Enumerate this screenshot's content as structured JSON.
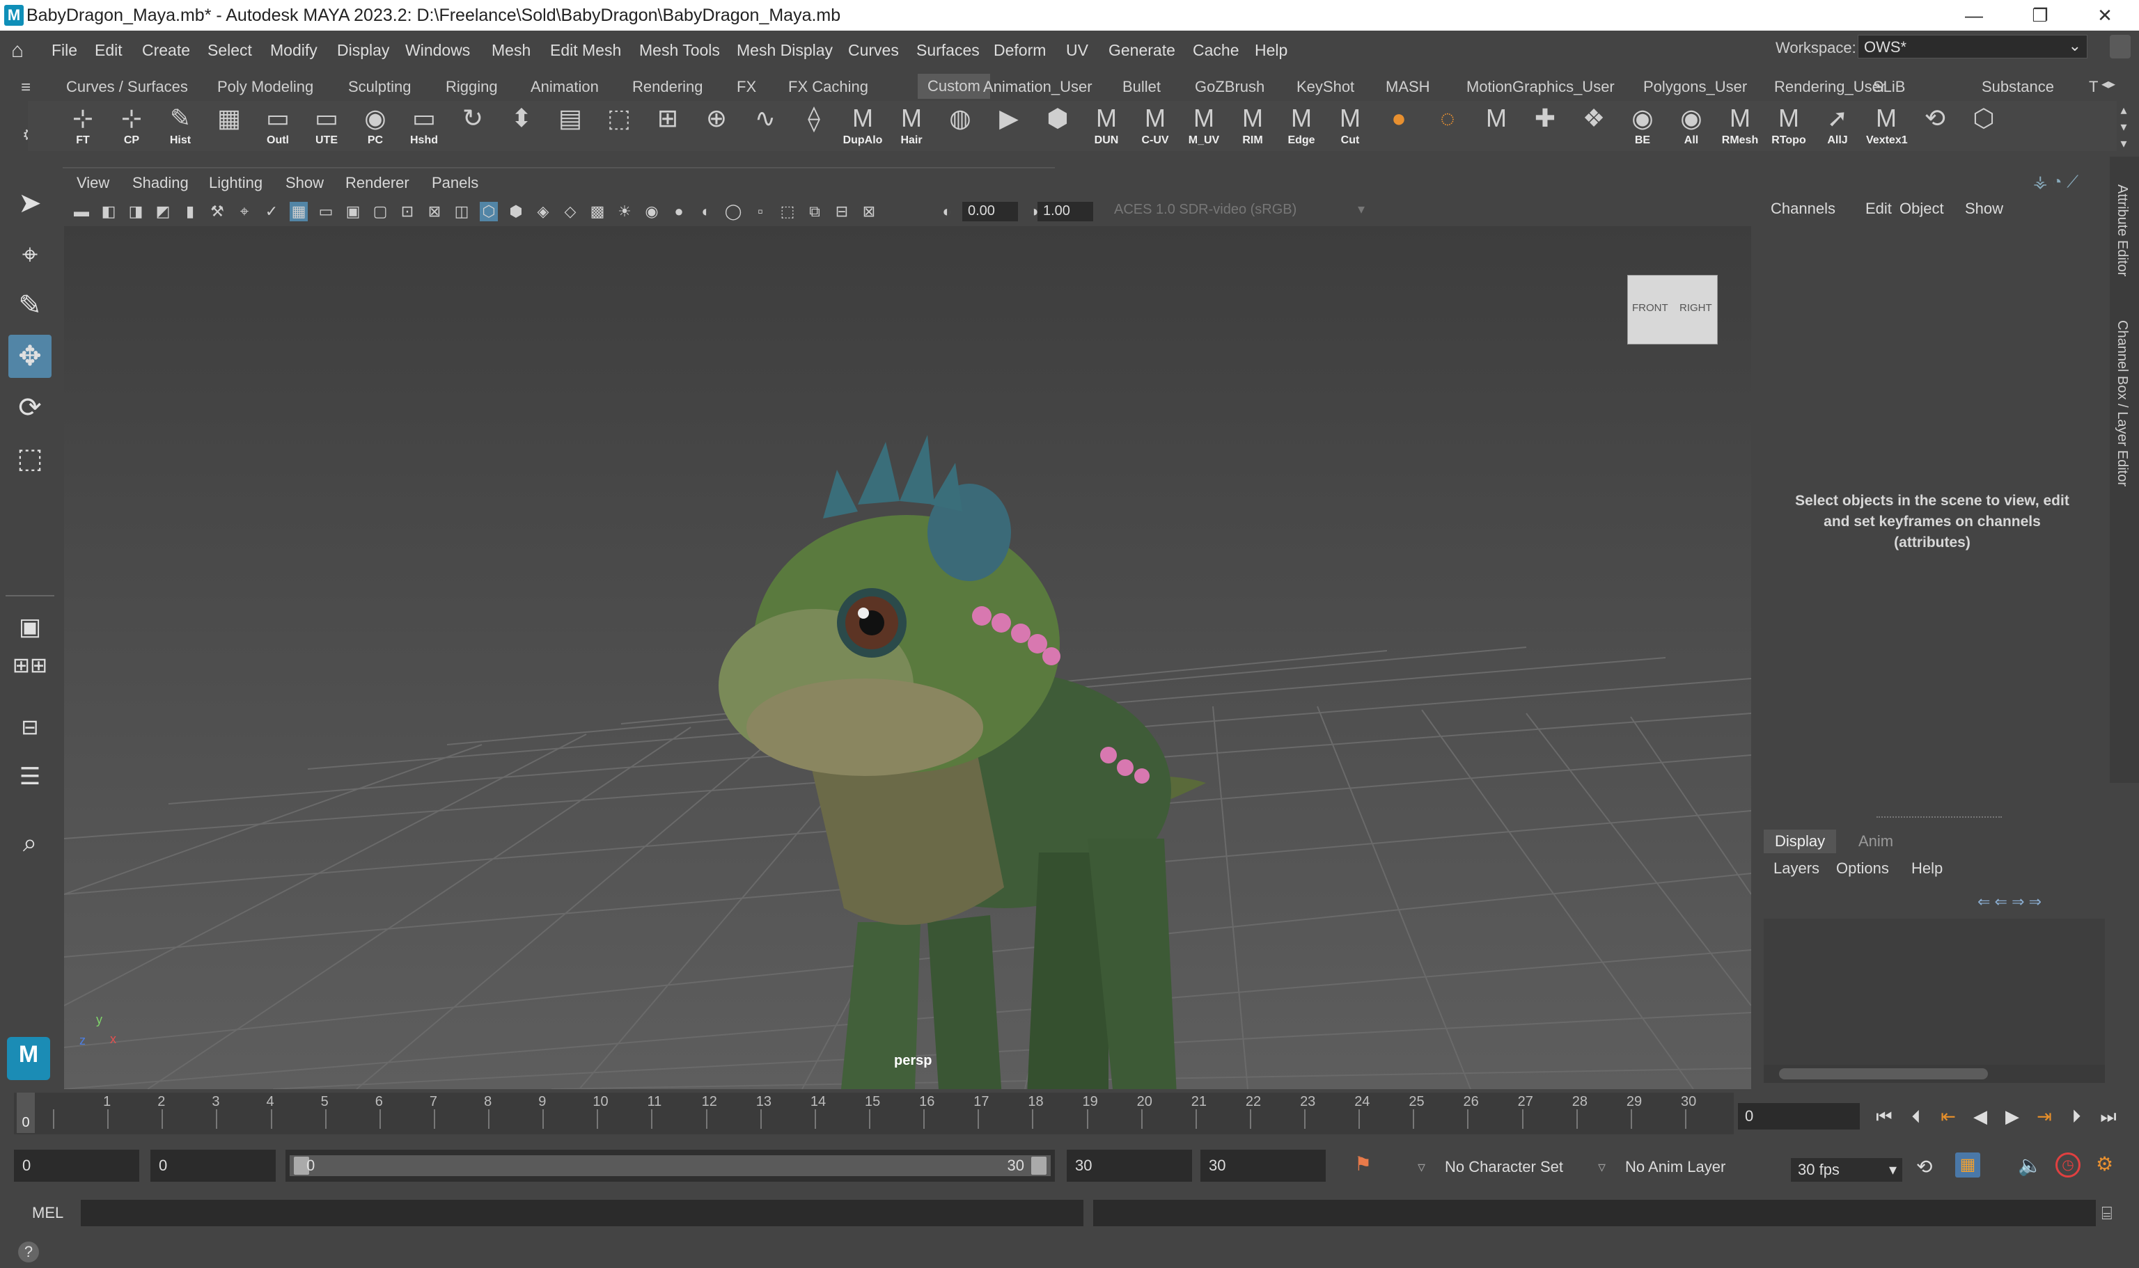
{
  "window": {
    "title": "BabyDragon_Maya.mb* - Autodesk MAYA 2023.2: D:\\Freelance\\Sold\\BabyDragon\\BabyDragon_Maya.mb",
    "app_icon": "M",
    "minimize": "—",
    "maximize": "❐",
    "close": "✕"
  },
  "menubar": {
    "items": [
      "File",
      "Edit",
      "Create",
      "Select",
      "Modify",
      "Display",
      "Windows",
      "Mesh",
      "Edit Mesh",
      "Mesh Tools",
      "Mesh Display",
      "Curves",
      "Surfaces",
      "Deform",
      "UV",
      "Generate",
      "Cache",
      "Help"
    ],
    "workspace_label": "Workspace:",
    "workspace_value": "OWS*"
  },
  "shelf": {
    "tabs": [
      "Curves / Surfaces",
      "Poly Modeling",
      "Sculpting",
      "Rigging",
      "Animation",
      "Rendering",
      "FX",
      "FX Caching",
      "Custom",
      "Animation_User",
      "Bullet",
      "GoZBrush",
      "KeyShot",
      "MASH",
      "MotionGraphics_User",
      "Polygons_User",
      "Rendering_User",
      "SLiB",
      "Substance",
      "T"
    ],
    "active_tab": "Custom",
    "icons": [
      {
        "label": "FT"
      },
      {
        "label": "CP"
      },
      {
        "label": "Hist"
      },
      {
        "label": ""
      },
      {
        "label": "Outl"
      },
      {
        "label": "UTE"
      },
      {
        "label": "PC"
      },
      {
        "label": "Hshd"
      },
      {
        "label": ""
      },
      {
        "label": ""
      },
      {
        "label": ""
      },
      {
        "label": ""
      },
      {
        "label": ""
      },
      {
        "label": ""
      },
      {
        "label": ""
      },
      {
        "label": ""
      },
      {
        "label": "DupAlo"
      },
      {
        "label": "Hair"
      },
      {
        "label": ""
      },
      {
        "label": ""
      },
      {
        "label": ""
      },
      {
        "label": "DUN"
      },
      {
        "label": "C-UV"
      },
      {
        "label": "M_UV"
      },
      {
        "label": "RIM"
      },
      {
        "label": "Edge"
      },
      {
        "label": "Cut"
      },
      {
        "label": ""
      },
      {
        "label": ""
      },
      {
        "label": ""
      },
      {
        "label": ""
      },
      {
        "label": ""
      },
      {
        "label": "BE"
      },
      {
        "label": "All"
      },
      {
        "label": "RMesh"
      },
      {
        "label": "RTopo"
      },
      {
        "label": "AllJ"
      },
      {
        "label": "Vextex1"
      },
      {
        "label": ""
      },
      {
        "label": ""
      }
    ]
  },
  "viewport": {
    "menu": [
      "View",
      "Shading",
      "Lighting",
      "Show",
      "Renderer",
      "Panels"
    ],
    "exposure": "0.00",
    "gamma": "1.00",
    "color_space": "ACES 1.0 SDR-video (sRGB)",
    "camera_label": "persp",
    "viewcube": {
      "front": "FRONT",
      "right": "RIGHT"
    },
    "axis": {
      "y": "y",
      "x": "x",
      "z": "z"
    }
  },
  "channel_box": {
    "menu": [
      "Channels",
      "Edit",
      "Object",
      "Show"
    ],
    "message": "Select objects in the scene to view, edit and set keyframes on channels (attributes)"
  },
  "layer_editor": {
    "tabs": [
      "Display",
      "Anim"
    ],
    "active_tab": "Display",
    "menu": [
      "Layers",
      "Options",
      "Help"
    ]
  },
  "side_tabs": [
    "Attribute Editor",
    "Channel Box / Layer Editor"
  ],
  "timeline": {
    "start": 0,
    "end": 30,
    "current": "0",
    "ticks": [
      "0",
      "1",
      "2",
      "3",
      "4",
      "5",
      "6",
      "7",
      "8",
      "9",
      "10",
      "11",
      "12",
      "13",
      "14",
      "15",
      "16",
      "17",
      "18",
      "19",
      "20",
      "21",
      "22",
      "23",
      "24",
      "25",
      "26",
      "27",
      "28",
      "29",
      "30"
    ],
    "frame_field": "0"
  },
  "range": {
    "anim_start": "0",
    "play_start": "0",
    "slider_start": "0",
    "slider_end": "30",
    "play_end": "30",
    "anim_end": "30",
    "character_set": "No Character Set",
    "anim_layer": "No Anim Layer",
    "fps": "30 fps"
  },
  "command_line": {
    "label": "MEL"
  },
  "colors": {
    "accent": "#5285a6",
    "bg": "#444444",
    "dragon_green": "#4d6e3a",
    "dragon_spikes": "#d878b0"
  }
}
